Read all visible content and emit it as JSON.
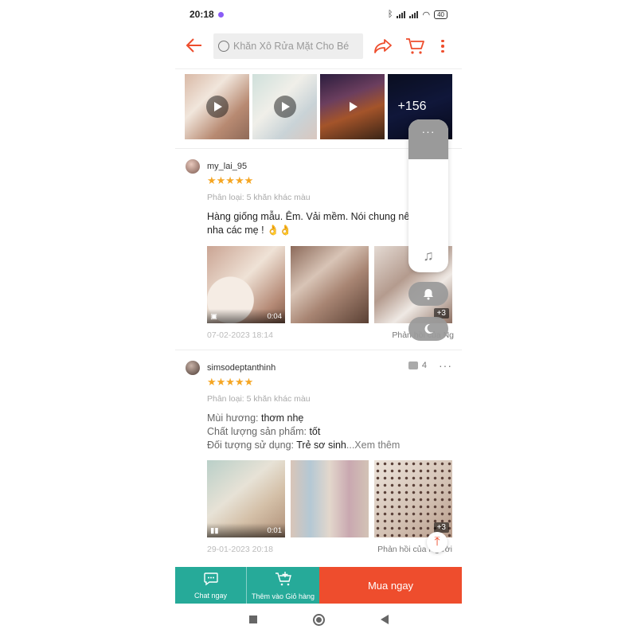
{
  "status_bar": {
    "time": "20:18",
    "battery": "40"
  },
  "search": {
    "placeholder": "Khăn Xô Rửa Mặt Cho Bé"
  },
  "media_strip": {
    "more_count": "+156"
  },
  "reviews": [
    {
      "username": "my_lai_95",
      "stars": "★★★★★",
      "variation": "Phân loại: 5 khăn khác màu",
      "text_line1": "Hàng giống mẫu. Êm. Vải mềm. Nói chung nê",
      "text_line2": "nha các mẹ ! 👌👌",
      "video_duration": "0:04",
      "extra_photos": "+3",
      "date": "07-02-2023 18:14",
      "reply": "Phản hồi của Ng"
    },
    {
      "username": "simsodeptanthinh",
      "likes": "4",
      "stars": "★★★★★",
      "variation": "Phân loại: 5 khăn khác màu",
      "label_scent": "Mùi hương:",
      "value_scent": "thơm nhẹ",
      "label_quality": "Chất lượng sản phẩm:",
      "value_quality": "tốt",
      "label_target": "Đối tượng sử dụng:",
      "value_target": "Trẻ sơ sinh",
      "see_more": "...Xem thêm",
      "video_duration": "0:01",
      "extra_photos": "+3",
      "date": "29-01-2023 20:18",
      "reply": "Phản hồi của Người"
    }
  ],
  "bottom_bar": {
    "chat": "Chat ngay",
    "add_cart": "Thêm vào Giỏ hàng",
    "buy": "Mua ngay"
  },
  "colors": {
    "brand": "#ee4d2d",
    "teal": "#26aa99",
    "star": "#f5a623"
  }
}
